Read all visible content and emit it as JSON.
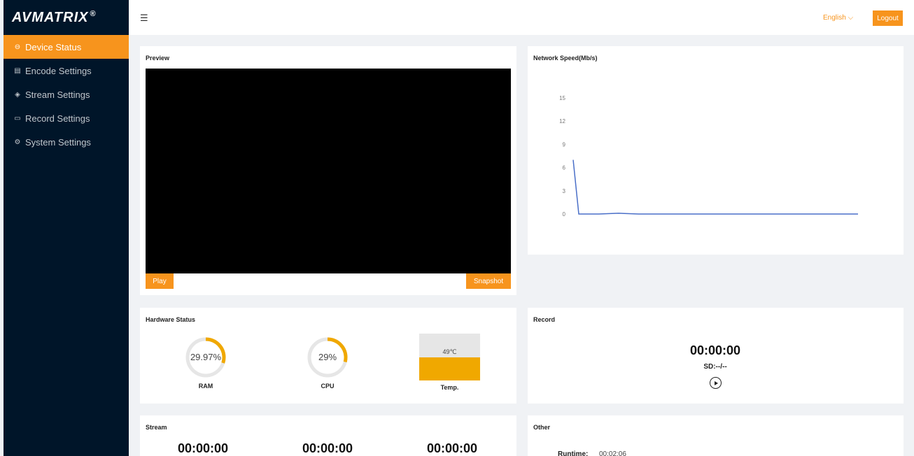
{
  "brand": {
    "logo_text": "AVMATRIX",
    "registered": "®"
  },
  "sidebar": {
    "items": [
      {
        "label": "Device Status",
        "icon": "dashboard-icon",
        "active": true
      },
      {
        "label": "Encode Settings",
        "icon": "list-icon",
        "active": false
      },
      {
        "label": "Stream Settings",
        "icon": "stream-icon",
        "active": false
      },
      {
        "label": "Record Settings",
        "icon": "record-icon",
        "active": false
      },
      {
        "label": "System Settings",
        "icon": "gear-icon",
        "active": false
      }
    ]
  },
  "topbar": {
    "language": "English",
    "logout": "Logout"
  },
  "preview": {
    "title": "Preview",
    "play": "Play",
    "snapshot": "Snapshot"
  },
  "network": {
    "title": "Network Speed(Mb/s)"
  },
  "chart_data": {
    "type": "line",
    "title": "Network Speed(Mb/s)",
    "ylim": [
      0,
      15
    ],
    "yticks": [
      "15",
      "12",
      "9",
      "6",
      "3",
      "0"
    ],
    "grid": false,
    "series": [
      {
        "values": [
          7,
          0,
          0,
          0.1,
          0,
          0,
          0,
          0,
          0,
          0,
          0,
          0,
          0,
          0,
          0,
          0
        ]
      }
    ]
  },
  "hardware": {
    "title": "Hardware Status",
    "ram": {
      "value": "29.97%",
      "label": "RAM",
      "percent": 29.97
    },
    "cpu": {
      "value": "29%",
      "label": "CPU",
      "percent": 29
    },
    "temp": {
      "value": "49℃",
      "label": "Temp.",
      "fill_fraction": 0.49
    }
  },
  "record": {
    "title": "Record",
    "time": "00:00:00",
    "sd": "SD:--/--"
  },
  "stream": {
    "title": "Stream",
    "times": [
      "00:00:00",
      "00:00:00",
      "00:00:00"
    ]
  },
  "other": {
    "title": "Other",
    "runtime_label": "Runtime:",
    "runtime_value": "00:02:06"
  },
  "colors": {
    "accent": "#f7941d",
    "sidebar_bg": "#001529",
    "gauge": "#f0a800",
    "line": "#4a6fc8"
  }
}
